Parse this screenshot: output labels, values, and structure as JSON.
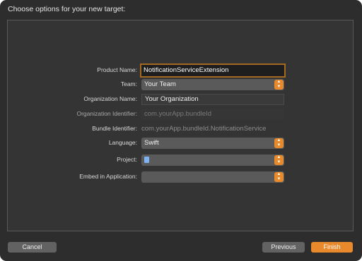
{
  "dialog": {
    "title": "Choose options for your new target:"
  },
  "form": {
    "product_name": {
      "label": "Product Name:",
      "value": "NotificationServiceExtension"
    },
    "team": {
      "label": "Team:",
      "value": "Your Team"
    },
    "organization_name": {
      "label": "Organization Name:",
      "value": "Your Organization"
    },
    "organization_identifier": {
      "label": "Organization Identifier:",
      "value": "com.yourApp.bundleId"
    },
    "bundle_identifier": {
      "label": "Bundle Identifier:",
      "value": "com.yourApp.bundleId.NotificationService"
    },
    "language": {
      "label": "Language:",
      "value": "Swift"
    },
    "project": {
      "label": "Project:",
      "value": ""
    },
    "embed_in_application": {
      "label": "Embed in Application:",
      "value": ""
    }
  },
  "buttons": {
    "cancel": "Cancel",
    "previous": "Previous",
    "finish": "Finish"
  },
  "colors": {
    "accent": "#e8892b",
    "focus_ring": "#a46a21",
    "window_bg": "#2d2d2d"
  },
  "icons": {
    "stepper": "chevron-up-down-icon",
    "project_file": "document-icon"
  }
}
